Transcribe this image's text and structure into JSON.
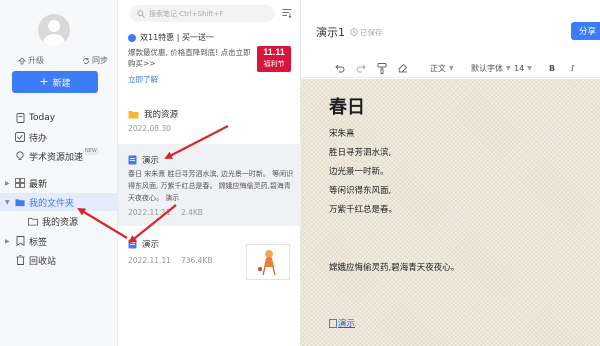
{
  "sidebar": {
    "upgrade_label": "升级",
    "sync_label": "同步",
    "new_button_label": "新建",
    "items": [
      {
        "label": "Today"
      },
      {
        "label": "待办"
      },
      {
        "label": "学术资源加速",
        "badge": "NEW"
      },
      {
        "label": "最新"
      },
      {
        "label": "我的文件夹"
      },
      {
        "label": "我的资源"
      },
      {
        "label": "标签"
      },
      {
        "label": "回收站"
      }
    ]
  },
  "note_list": {
    "search_placeholder": "搜索笔记 Ctrl+Shift+F",
    "promo": {
      "title": "双11特惠 | 买一送一",
      "description": "爆款最优惠, 价格直降到底! 点击立即购买>>",
      "link": "立即了解",
      "badge_top": "11.11",
      "badge_bottom": "福利节"
    },
    "notes": [
      {
        "title": "我的资源",
        "date": "2022.08.30"
      },
      {
        "title": "演示",
        "body": "春日 宋朱熹 胜日寻芳泗水滨, 边光景一时新。 等闲识得东风面, 万紫千红总是春。 嫦娥应悔偷灵药,碧海青天夜夜心。 演示",
        "date": "2022.11.11",
        "size": "2.4KB"
      },
      {
        "title": "演示",
        "date": "2022.11.11",
        "size": "736.4KB"
      }
    ]
  },
  "editor": {
    "title": "演示1",
    "saved_label": "已保存",
    "share_label": "分享",
    "toolbar": {
      "paragraph": "正文",
      "font": "默认字体",
      "size": "14",
      "bold": "B",
      "italic": "I"
    },
    "doc": {
      "heading": "春日",
      "lines": [
        "宋朱熹",
        "胜日寻芳泗水滨,",
        "边光景一时新。",
        "等闲识得东风面,",
        "万紫千红总是春。"
      ],
      "extra_line": "嫦娥应悔偷灵药,碧海青天夜夜心。",
      "link": "演示"
    }
  },
  "colors": {
    "accent": "#3d7cf7",
    "promo_badge": "#d9153b",
    "arrow": "#d8262b"
  }
}
